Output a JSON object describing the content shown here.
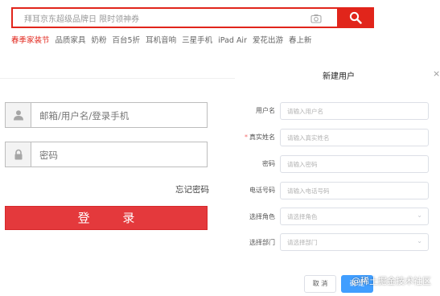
{
  "search": {
    "placeholder": "拜耳京东超级品牌日 限时领神券",
    "icons": {
      "camera": "camera-icon",
      "search": "search-icon"
    }
  },
  "hotwords": [
    "春季家装节",
    "品质家具",
    "奶粉",
    "百台5折",
    "耳机音响",
    "三星手机",
    "iPad Air",
    "爱花出游",
    "春上新"
  ],
  "login": {
    "username_placeholder": "邮箱/用户名/登录手机",
    "password_placeholder": "密码",
    "forgot_label": "忘记密码",
    "submit_label": "登 录",
    "icons": {
      "user": "user-icon",
      "lock": "lock-icon"
    }
  },
  "modal": {
    "title": "新建用户",
    "close": "×",
    "fields": [
      {
        "label": "用户名",
        "placeholder": "请输入用户名",
        "required": false
      },
      {
        "label": "真实姓名",
        "placeholder": "请输入真实姓名",
        "required": true,
        "required_mark": "*"
      },
      {
        "label": "密码",
        "placeholder": "请输入密码",
        "required": false
      },
      {
        "label": "电话号码",
        "placeholder": "请输入电话号码",
        "required": false
      },
      {
        "label": "选择角色",
        "placeholder": "请选择角色",
        "required": false,
        "caret": "⌄"
      },
      {
        "label": "选择部门",
        "placeholder": "请选择部门",
        "required": false,
        "caret": "⌄"
      }
    ],
    "cancel_label": "取 消",
    "confirm_label": "确 定"
  },
  "watermark": "@稀土掘金技术社区",
  "colors": {
    "brand_red": "#e1251b",
    "primary_blue": "#409eff"
  }
}
